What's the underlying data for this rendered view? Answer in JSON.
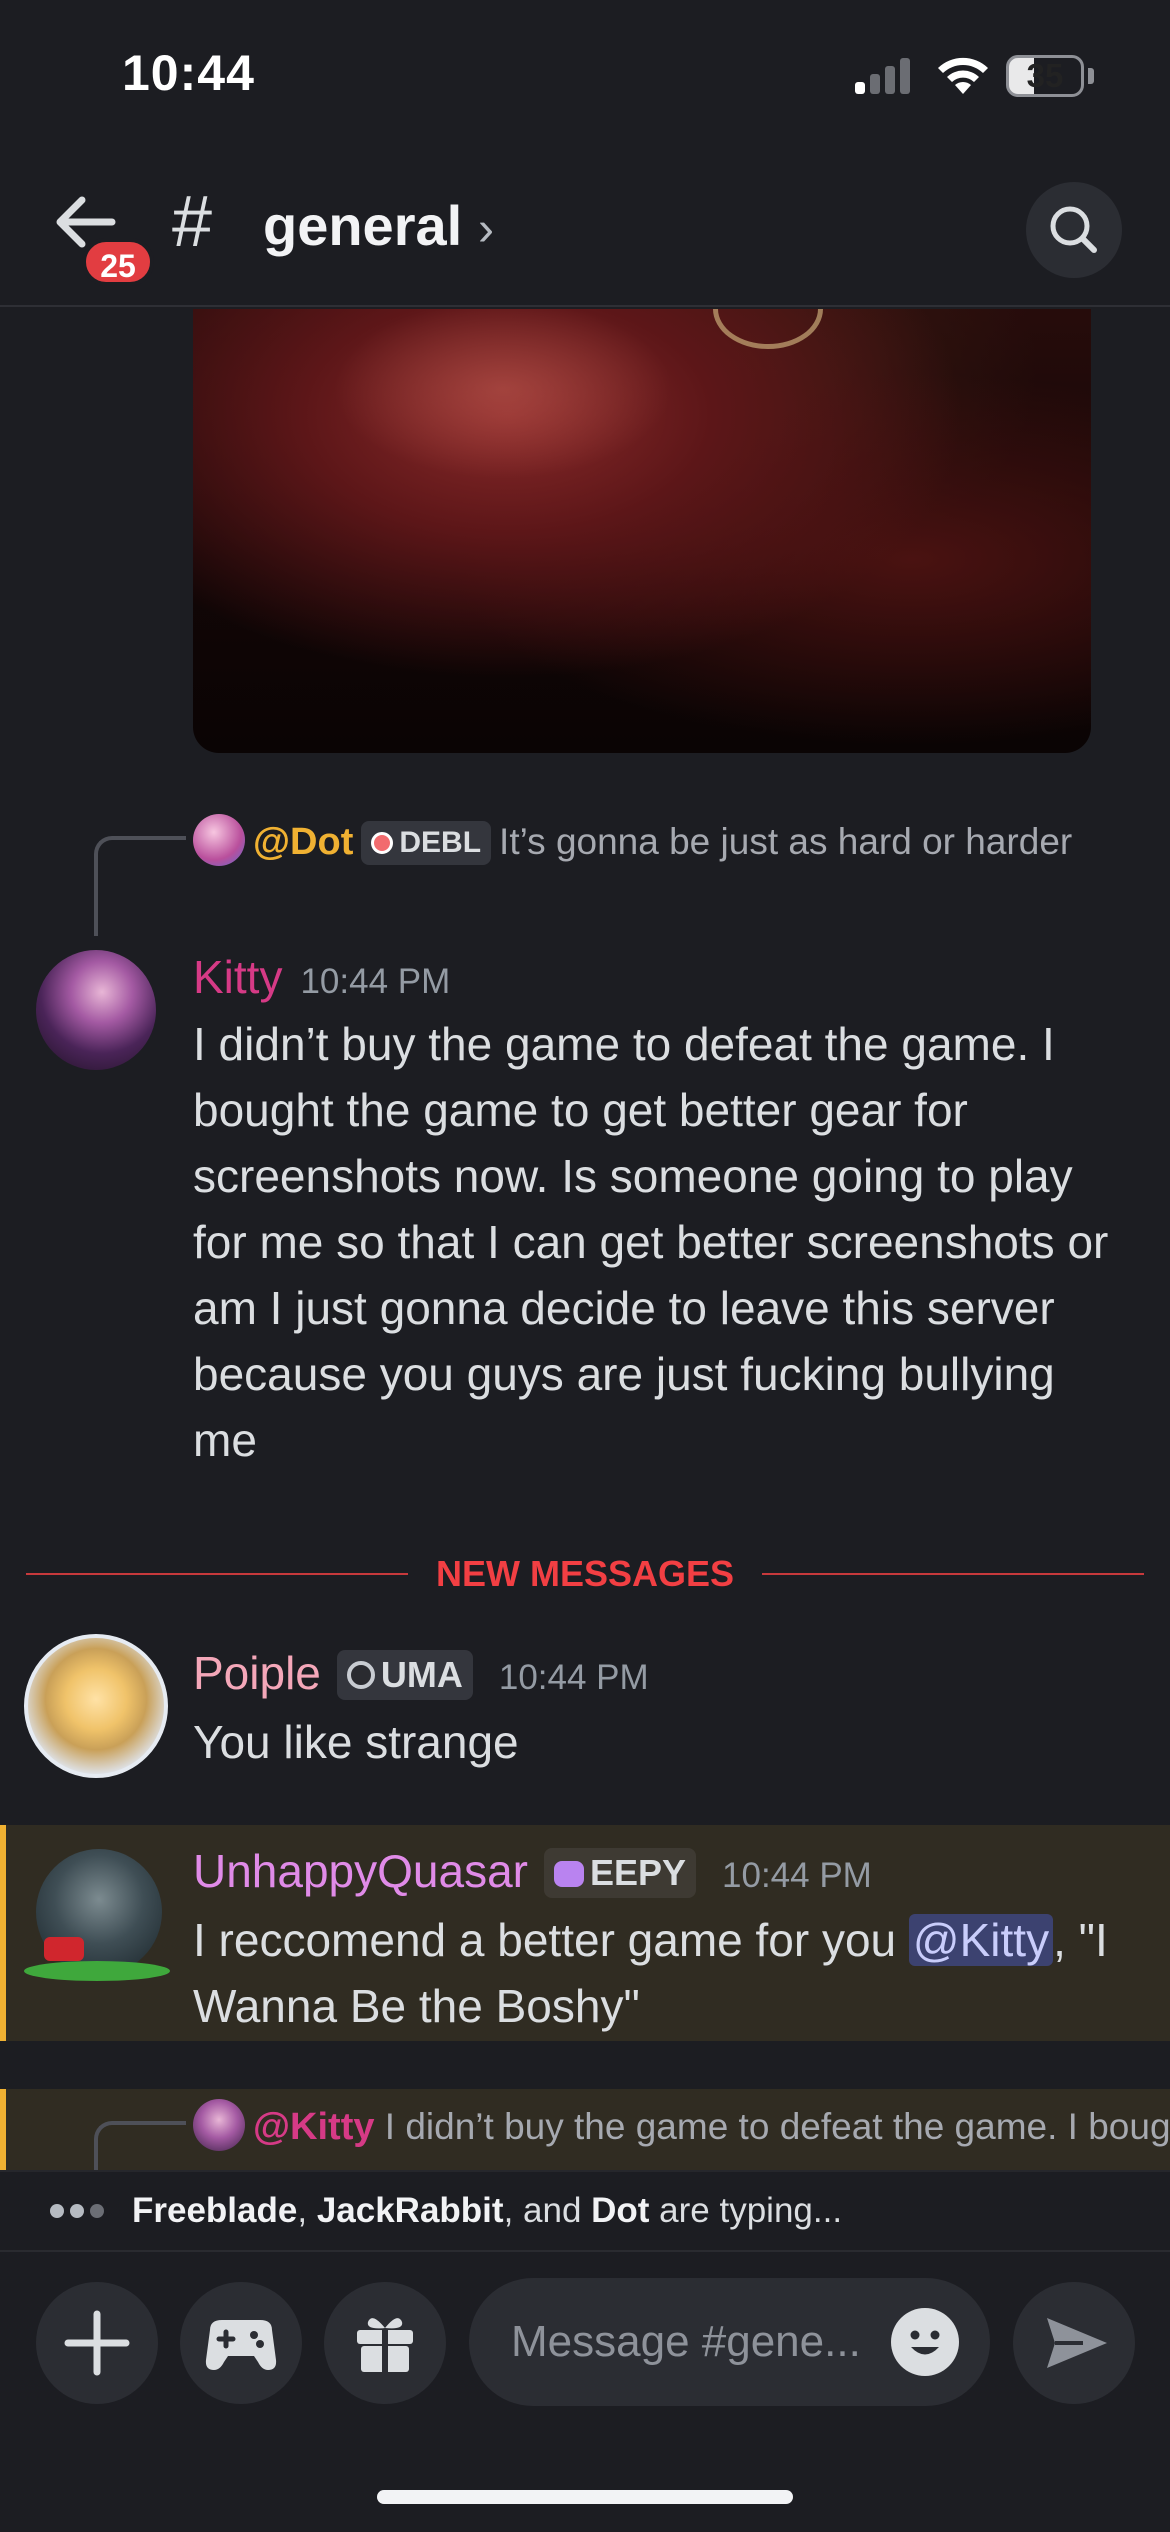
{
  "status_bar": {
    "time": "10:44",
    "battery": "35"
  },
  "header": {
    "badge_count": "25",
    "hash": "#",
    "channel": "general",
    "chevron": "›"
  },
  "messages": {
    "reply1": {
      "mention": "@Dot",
      "tag": "DEBL",
      "text": "It’s gonna be just as hard or harder"
    },
    "kitty": {
      "author": "Kitty",
      "time": "10:44 PM",
      "text": "I didn’t buy the game to defeat the game. I bought the game to get better gear for screenshots now. Is someone going to play for me so that I can get better screenshots or am I just gonna decide to leave this server because you guys are just fucking bullying me"
    },
    "divider_label": "NEW MESSAGES",
    "poiple": {
      "author": "Poiple",
      "tag": "UMA",
      "time": "10:44 PM",
      "text": "You like strange"
    },
    "quasar": {
      "author": "UnhappyQuasar",
      "tag": "EEPY",
      "time": "10:44 PM",
      "text_before": "I reccomend a better game for you ",
      "mention": "@Kitty",
      "text_after": ", \"I Wanna Be the Boshy\""
    },
    "reply2": {
      "mention": "@Kitty",
      "text": "I didn’t buy the game to defeat the game. I bought the game to get better gear for"
    }
  },
  "typing": {
    "user1": "Freeblade",
    "sep1": ", ",
    "user2": "JackRabbit",
    "sep2": ", and ",
    "user3": "Dot",
    "suffix": " are typing..."
  },
  "composer": {
    "placeholder": "Message #gene..."
  },
  "colors": {
    "kitty": "#d63a86",
    "poiple": "#f4a7b9",
    "quasar": "#e08be8",
    "dot": "#f0b132",
    "new_messages": "#f23f43",
    "mention_bg": "#3c4270"
  }
}
